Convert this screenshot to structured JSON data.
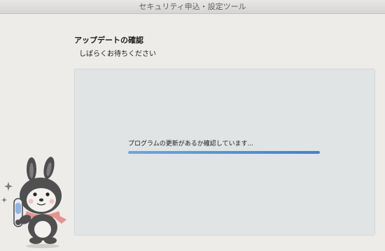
{
  "window": {
    "title": "セキュリティ申込・設定ツール"
  },
  "header": {
    "title": "アップデートの確認",
    "subtitle": "しばらくお待ちください"
  },
  "status": {
    "message": "プログラムの更新があるか確認しています...",
    "progress": 1.0
  },
  "colors": {
    "progress": "#3b82d6",
    "panel": "#e0e4e5",
    "background": "#ecebe8"
  },
  "icons": [
    "rabbit-mascot-icon",
    "sparkle-icon",
    "magnifier-icon"
  ]
}
